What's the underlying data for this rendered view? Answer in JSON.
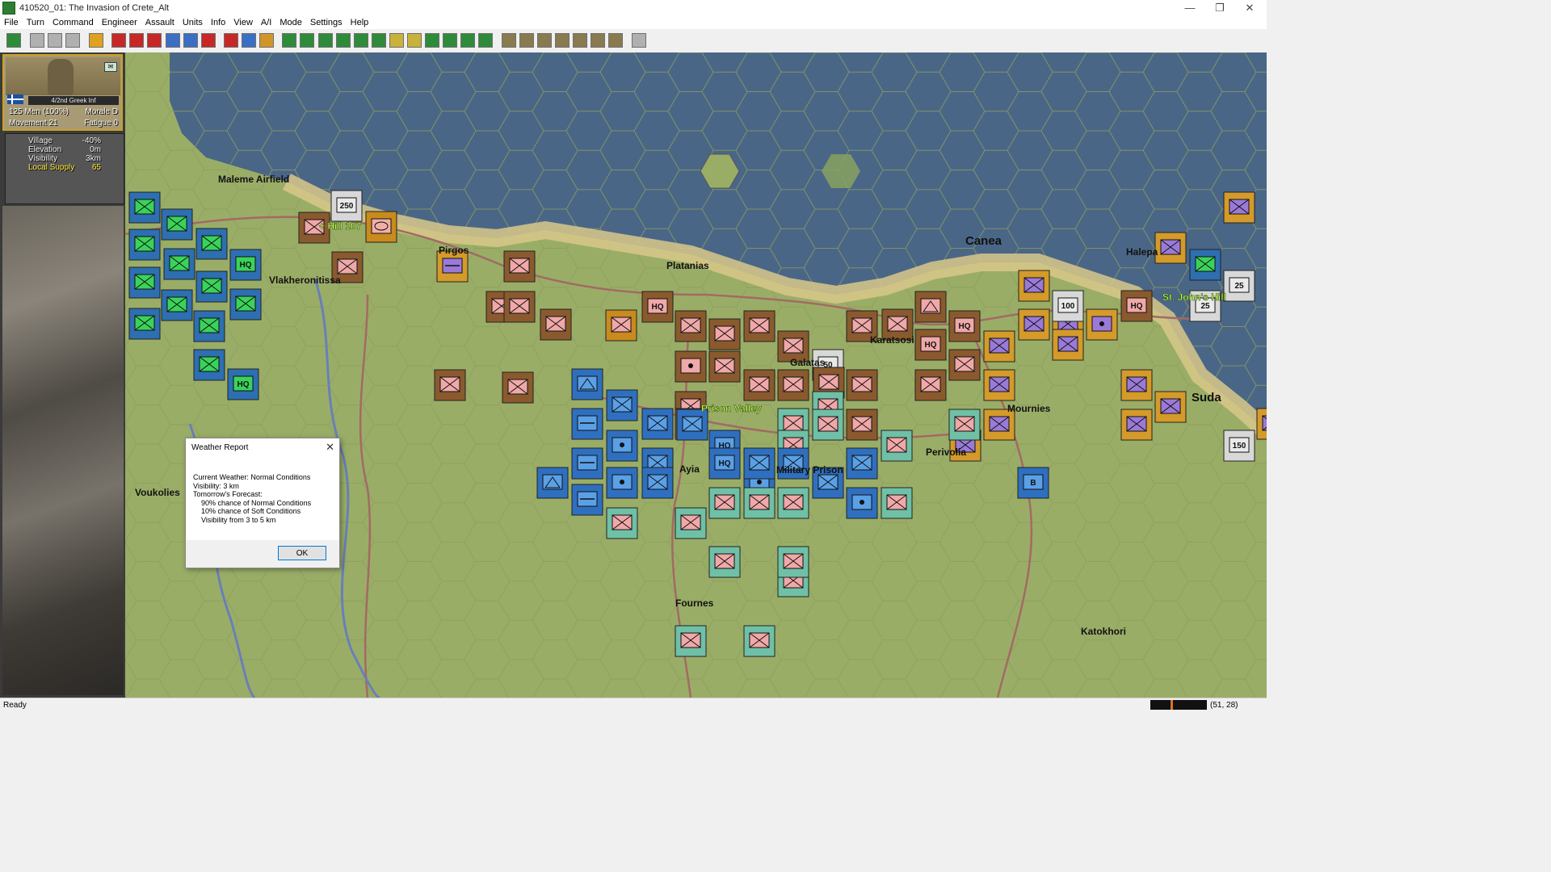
{
  "window": {
    "title": "410520_01: The Invasion of Crete_Alt",
    "min": "—",
    "max": "❐",
    "close": "✕"
  },
  "menu": [
    "File",
    "Turn",
    "Command",
    "Engineer",
    "Assault",
    "Units",
    "Info",
    "View",
    "A/I",
    "Mode",
    "Settings",
    "Help"
  ],
  "toolbar": {
    "buttons": [
      {
        "icon": "target-icon",
        "color": "#2e8b3a"
      },
      {
        "icon": "page-icon",
        "color": "#b0b0b0"
      },
      {
        "icon": "folder-icon",
        "color": "#b0b0b0"
      },
      {
        "icon": "save-icon",
        "color": "#b0b0b0"
      },
      {
        "icon": "sun-icon",
        "color": "#e0a020"
      },
      {
        "icon": "shield-icon",
        "color": "#c62828"
      },
      {
        "icon": "fire-icon",
        "color": "#c62828"
      },
      {
        "icon": "artillery-icon",
        "color": "#c62828"
      },
      {
        "icon": "plane-icon",
        "color": "#3a6fc4"
      },
      {
        "icon": "airstrike-icon",
        "color": "#3a6fc4"
      },
      {
        "icon": "stack-icon",
        "color": "#c62828"
      },
      {
        "icon": "tools-icon",
        "color": "#c62828"
      },
      {
        "icon": "globe-icon",
        "color": "#3a6fc4"
      },
      {
        "icon": "chest-icon",
        "color": "#d0962a"
      },
      {
        "icon": "zoom-in-icon",
        "color": "#2e8b3a"
      },
      {
        "icon": "zoom-out-icon",
        "color": "#2e8b3a"
      },
      {
        "icon": "grid-icon",
        "color": "#2e8b3a"
      },
      {
        "icon": "frame-icon",
        "color": "#2e8b3a"
      },
      {
        "icon": "eye-icon",
        "color": "#2e8b3a"
      },
      {
        "icon": "flag-icon",
        "color": "#2e8b3a"
      },
      {
        "icon": "bomb-icon",
        "color": "#c9b23a"
      },
      {
        "icon": "clock-icon",
        "color": "#c9b23a"
      },
      {
        "icon": "ship-icon",
        "color": "#2e8b3a"
      },
      {
        "icon": "monitor-icon",
        "color": "#2e8b3a"
      },
      {
        "icon": "map-icon",
        "color": "#2e8b3a"
      },
      {
        "icon": "route-icon",
        "color": "#2e8b3a"
      },
      {
        "icon": "lock-icon",
        "color": "#8a7a50"
      },
      {
        "icon": "binoculars-icon",
        "color": "#8a7a50"
      },
      {
        "icon": "unit-icon",
        "color": "#8a7a50"
      },
      {
        "icon": "medal-icon",
        "color": "#8a7a50"
      },
      {
        "icon": "bars-icon",
        "color": "#8a7a50"
      },
      {
        "icon": "tree-icon",
        "color": "#8a7a50"
      },
      {
        "icon": "info-icon",
        "color": "#8a7a50"
      },
      {
        "icon": "help-icon",
        "color": "#b0b0b0"
      }
    ]
  },
  "unit": {
    "name": "4/2nd Greek Inf",
    "men": "125 Men (100%)",
    "morale": "Morale D",
    "movement": "Movement 21",
    "fatigue": "Fatigue 0",
    "flag_icon": "greek-flag-icon",
    "mail_icon": "mail-icon"
  },
  "terrain": [
    {
      "label": "Village",
      "value": "-40%"
    },
    {
      "label": "Elevation",
      "value": "0m"
    },
    {
      "label": "Visibility",
      "value": "3km"
    },
    {
      "label": "Local Supply",
      "value": "65",
      "highlight": true
    }
  ],
  "map": {
    "colors": {
      "sea": "#4a6687",
      "land": "#9aad67",
      "beach": "#d8c889",
      "road": "#a36a64",
      "river": "#6a7fb8"
    },
    "places": [
      {
        "name": "Maleme Airfield",
        "style": "normal"
      },
      {
        "name": "+ Hill 107",
        "style": "green"
      },
      {
        "name": "Pirgos",
        "style": "normal"
      },
      {
        "name": "Vlakheronitissa",
        "style": "normal"
      },
      {
        "name": "Platanias",
        "style": "normal"
      },
      {
        "name": "Canea",
        "style": "big"
      },
      {
        "name": "Halepa",
        "style": "normal"
      },
      {
        "name": "St. John's Hill",
        "style": "green"
      },
      {
        "name": "Karatsosi",
        "style": "normal"
      },
      {
        "name": "Galatas",
        "style": "normal"
      },
      {
        "name": "Prison Valley",
        "style": "green"
      },
      {
        "name": "Mournies",
        "style": "normal"
      },
      {
        "name": "Suda",
        "style": "big"
      },
      {
        "name": "Perivolia",
        "style": "normal"
      },
      {
        "name": "Military Prison",
        "style": "normal"
      },
      {
        "name": "Ayia",
        "style": "normal"
      },
      {
        "name": "Voukolies",
        "style": "normal"
      },
      {
        "name": "Fournes",
        "style": "normal"
      },
      {
        "name": "Katokhori",
        "style": "normal"
      }
    ],
    "counters": [
      {
        "type": "green",
        "sym": "box"
      },
      {
        "type": "green",
        "sym": "box"
      },
      {
        "type": "green",
        "sym": "box"
      },
      {
        "type": "green",
        "sym": "box"
      },
      {
        "type": "green",
        "sym": "HQ"
      },
      {
        "type": "green",
        "sym": "box"
      },
      {
        "type": "green",
        "sym": "box"
      },
      {
        "type": "green",
        "sym": "box"
      },
      {
        "type": "green",
        "sym": "box"
      },
      {
        "type": "green",
        "sym": "box"
      },
      {
        "type": "green",
        "sym": "box"
      },
      {
        "type": "green",
        "sym": "HQ"
      },
      {
        "type": "green",
        "sym": "box"
      },
      {
        "type": "green",
        "sym": "box"
      },
      {
        "type": "brown",
        "sym": "x"
      },
      {
        "type": "flag",
        "sym": "250"
      },
      {
        "type": "brown",
        "sym": "x"
      },
      {
        "type": "pink",
        "sym": "oval"
      },
      {
        "type": "brown",
        "sym": "x"
      },
      {
        "type": "purple",
        "sym": "line"
      },
      {
        "type": "brown",
        "sym": "x"
      },
      {
        "type": "brown",
        "sym": "x"
      },
      {
        "type": "brown",
        "sym": "x"
      },
      {
        "type": "brown",
        "sym": "x"
      },
      {
        "type": "brown",
        "sym": "x"
      },
      {
        "type": "brown",
        "sym": "HQ"
      },
      {
        "type": "orange",
        "sym": "x"
      },
      {
        "type": "brown",
        "sym": "x"
      },
      {
        "type": "brown",
        "sym": "x"
      },
      {
        "type": "brown",
        "sym": "x"
      },
      {
        "type": "brown",
        "sym": "dot"
      },
      {
        "type": "brown",
        "sym": "x"
      },
      {
        "type": "brown",
        "sym": "x"
      },
      {
        "type": "brown",
        "sym": "x"
      },
      {
        "type": "flag",
        "sym": "50"
      },
      {
        "type": "brown",
        "sym": "x"
      },
      {
        "type": "brown",
        "sym": "x"
      },
      {
        "type": "brown",
        "sym": "tri"
      },
      {
        "type": "brown",
        "sym": "HQ"
      },
      {
        "type": "brown",
        "sym": "HQ"
      },
      {
        "type": "brown",
        "sym": "x"
      },
      {
        "type": "brown",
        "sym": "x"
      },
      {
        "type": "brown",
        "sym": "x"
      },
      {
        "type": "brown",
        "sym": "x"
      },
      {
        "type": "brown",
        "sym": "x"
      },
      {
        "type": "brown",
        "sym": "HQ"
      },
      {
        "type": "brown",
        "sym": "x"
      },
      {
        "type": "brown",
        "sym": "x"
      },
      {
        "type": "brown",
        "sym": "x"
      },
      {
        "type": "teal",
        "sym": "x"
      },
      {
        "type": "teal",
        "sym": "x"
      },
      {
        "type": "teal",
        "sym": "x"
      },
      {
        "type": "teal",
        "sym": "x"
      },
      {
        "type": "teal",
        "sym": "x"
      },
      {
        "type": "teal",
        "sym": "x"
      },
      {
        "type": "teal",
        "sym": "x"
      },
      {
        "type": "teal",
        "sym": "x"
      },
      {
        "type": "teal",
        "sym": "x"
      },
      {
        "type": "teal",
        "sym": "x"
      },
      {
        "type": "teal",
        "sym": "x"
      },
      {
        "type": "teal",
        "sym": "x"
      },
      {
        "type": "purple",
        "sym": "x"
      },
      {
        "type": "purple",
        "sym": "x"
      },
      {
        "type": "purple",
        "sym": "x"
      },
      {
        "type": "purple",
        "sym": "x"
      },
      {
        "type": "purple",
        "sym": "x"
      },
      {
        "type": "purple",
        "sym": "x"
      },
      {
        "type": "purple",
        "sym": "x"
      },
      {
        "type": "purple",
        "sym": "x"
      },
      {
        "type": "purple",
        "sym": "x"
      },
      {
        "type": "purple",
        "sym": "x"
      },
      {
        "type": "purple",
        "sym": "dot"
      },
      {
        "type": "purple",
        "sym": "x"
      },
      {
        "type": "purple",
        "sym": "x"
      },
      {
        "type": "purple",
        "sym": "x"
      },
      {
        "type": "flag",
        "sym": "100"
      },
      {
        "type": "flag",
        "sym": "25"
      },
      {
        "type": "flag",
        "sym": "25"
      },
      {
        "type": "flag",
        "sym": "150"
      },
      {
        "type": "brown",
        "sym": "HQ"
      },
      {
        "type": "green",
        "sym": "box"
      },
      {
        "type": "purple",
        "sym": "x"
      },
      {
        "type": "purple",
        "sym": "x"
      },
      {
        "type": "blue",
        "sym": "tri"
      },
      {
        "type": "blue",
        "sym": "x"
      },
      {
        "type": "blue",
        "sym": "bar"
      },
      {
        "type": "blue",
        "sym": "x"
      },
      {
        "type": "blue",
        "sym": "dot"
      },
      {
        "type": "blue",
        "sym": "bar"
      },
      {
        "type": "blue",
        "sym": "dot"
      },
      {
        "type": "blue",
        "sym": "x"
      },
      {
        "type": "blue",
        "sym": "bar"
      },
      {
        "type": "blue",
        "sym": "x"
      },
      {
        "type": "blue",
        "sym": "HQ"
      },
      {
        "type": "blue",
        "sym": "HQ"
      },
      {
        "type": "blue",
        "sym": "x"
      },
      {
        "type": "blue",
        "sym": "x"
      },
      {
        "type": "blue",
        "sym": "dot"
      },
      {
        "type": "blue",
        "sym": "x"
      },
      {
        "type": "blue",
        "sym": "dot"
      },
      {
        "type": "blue",
        "sym": "tri"
      },
      {
        "type": "blue",
        "sym": "x"
      },
      {
        "type": "blue",
        "sym": "x"
      },
      {
        "type": "blue",
        "sym": "B"
      },
      {
        "type": "teal",
        "sym": "x"
      },
      {
        "type": "teal",
        "sym": "x"
      },
      {
        "type": "teal",
        "sym": "x"
      },
      {
        "type": "teal",
        "sym": "x"
      },
      {
        "type": "teal",
        "sym": "x"
      },
      {
        "type": "teal",
        "sym": "x"
      },
      {
        "type": "teal",
        "sym": "x"
      }
    ]
  },
  "weather": {
    "title": "Weather Report",
    "close": "✕",
    "current": "Current Weather: Normal Conditions",
    "visibility": "Visibility: 3 km",
    "forecast_header": "Tomorrow's Forecast:",
    "forecast": [
      "90% chance of Normal Conditions",
      "10% chance of Soft Conditions",
      "Visibility from 3 to 5  km"
    ],
    "ok": "OK"
  },
  "status": {
    "text": "Ready",
    "coords": "(51, 28)",
    "gauge": 0.35
  }
}
